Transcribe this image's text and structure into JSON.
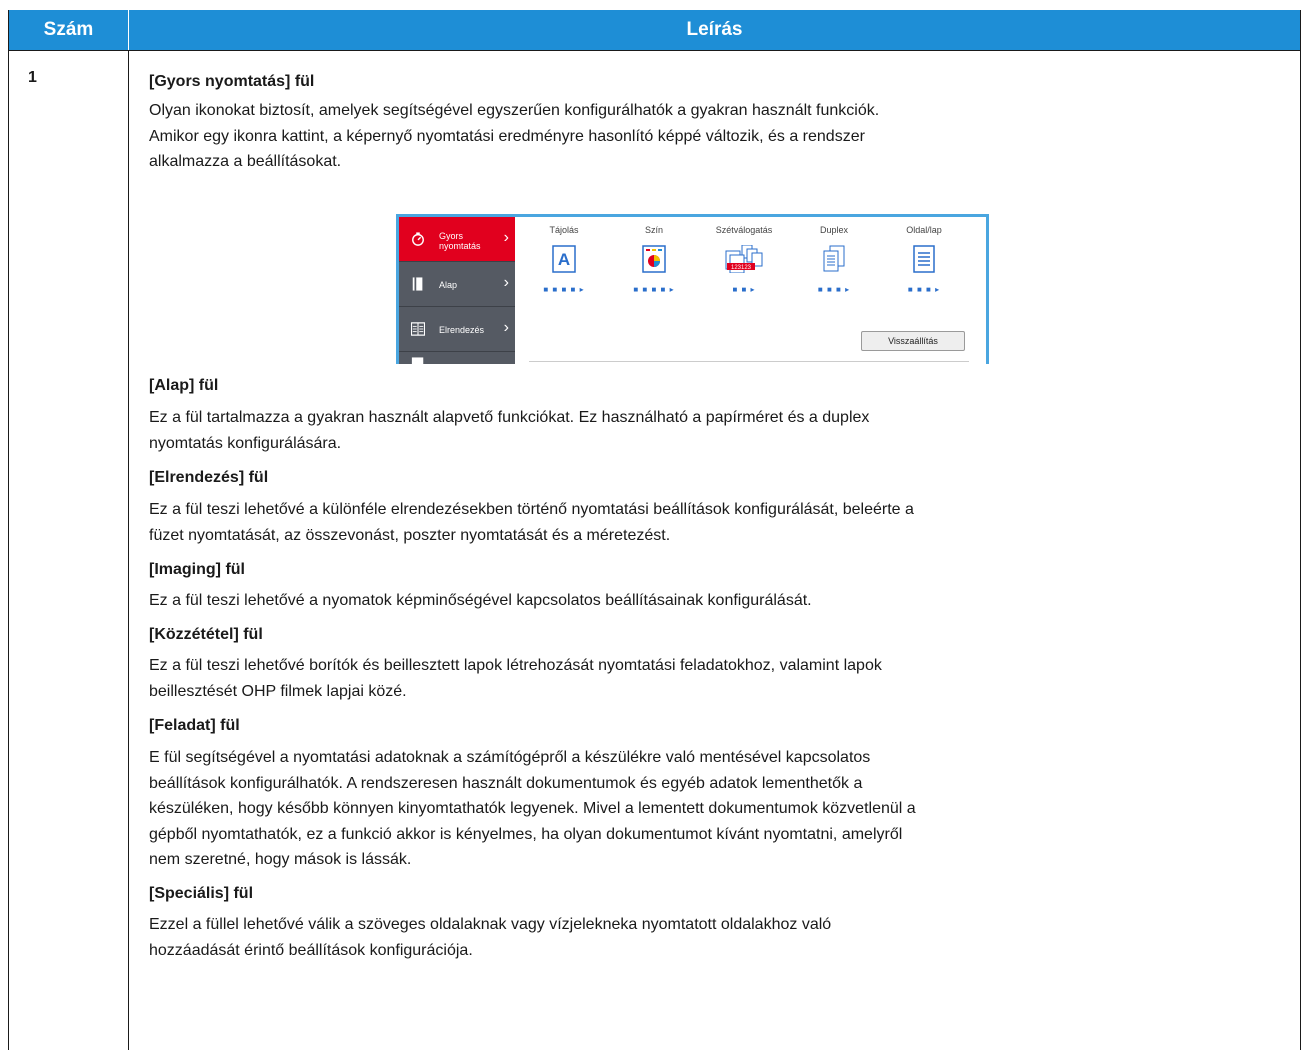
{
  "table": {
    "col_number_header": "Szám",
    "col_desc_header": "Leírás",
    "row_number": "1"
  },
  "sections": [
    {
      "heading": "[Gyors nyomtatás] fül",
      "lines": [
        "Olyan ikonokat biztosít, amelyek segítségével egyszerűen konfigurálhatók a gyakran használt funkciók.",
        "Amikor egy ikonra kattint, a képernyő nyomtatási eredményre hasonlító képpé változik, és a rendszer",
        "alkalmazza a beállításokat."
      ]
    },
    {
      "heading": "[Alap] fül",
      "lines": [
        "Ez a fül tartalmazza a gyakran használt alapvető funkciókat. Ez használható a papírméret és a duplex",
        "nyomtatás konfigurálására."
      ]
    },
    {
      "heading": "[Elrendezés] fül",
      "lines": [
        "Ez a fül teszi lehetővé a különféle elrendezésekben történő nyomtatási beállítások konfigurálását, beleérte a",
        "füzet nyomtatását, az összevonást, poszter nyomtatását és a méretezést."
      ]
    },
    {
      "heading": "[Imaging] fül",
      "lines": [
        "Ez a fül teszi lehetővé a nyomatok képminőségével kapcsolatos beállításainak konfigurálását."
      ]
    },
    {
      "heading": "[Közzététel] fül",
      "lines": [
        "Ez a fül teszi lehetővé borítók és beillesztett lapok létrehozását nyomtatási feladatokhoz, valamint lapok",
        "beillesztését OHP filmek lapjai közé."
      ]
    },
    {
      "heading": "[Feladat] fül",
      "lines": [
        "E fül segítségével a nyomtatási adatoknak a számítógépről a készülékre való mentésével kapcsolatos",
        "beállítások konfigurálhatók. A rendszeresen használt dokumentumok és egyéb adatok lementhetők a",
        "készüléken, hogy később könnyen kinyomtathatók legyenek. Mivel a lementett dokumentumok közvetlenül a",
        "gépből nyomtathatók, ez a funkció akkor is kényelmes, ha olyan dokumentumot kívánt nyomtatni, amelyről",
        "nem szeretné, hogy mások is lássák."
      ]
    },
    {
      "heading": "[Speciális] fül",
      "lines": [
        "Ezzel a füllel lehetővé válik a szöveges oldalaknak vagy vízjelekneka nyomtatott oldalakhoz való",
        "hozzáadását érintő beállítások konfigurációja."
      ]
    }
  ],
  "screenshot": {
    "sidebar": [
      {
        "label_line1": "Gyors",
        "label_line2": "nyomtatás",
        "icon": "stopwatch-icon"
      },
      {
        "label_line1": "Alap",
        "label_line2": "",
        "icon": "page-icon"
      },
      {
        "label_line1": "Elrendezés",
        "label_line2": "",
        "icon": "layout-icon"
      }
    ],
    "quick_columns": [
      {
        "label": "Tájolás",
        "icon": "orientation-icon"
      },
      {
        "label": "Szín",
        "icon": "color-icon"
      },
      {
        "label": "Szétválogatás",
        "icon": "collate-icon"
      },
      {
        "label": "Duplex",
        "icon": "duplex-icon"
      },
      {
        "label": "Oldal/lap",
        "icon": "pages-per-sheet-icon"
      }
    ],
    "reset_label": "Visszaállítás",
    "collate_icon_text": "123123",
    "orientation_icon_text": "A",
    "colors": {
      "accent_red": "#e1001e",
      "sidebar_gray": "#555a63",
      "header_blue": "#1e8ed6",
      "icon_blue": "#2a6ecb"
    }
  }
}
